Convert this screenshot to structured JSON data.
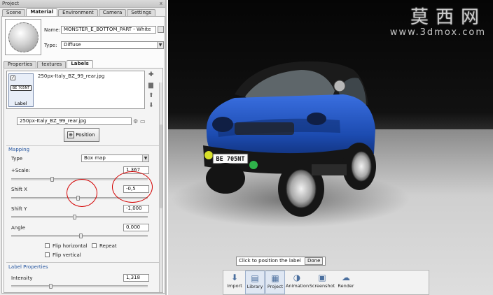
{
  "window": {
    "title": "Project",
    "close_glyph": "x"
  },
  "tabs_top": [
    {
      "label": "Scene",
      "active": false
    },
    {
      "label": "Material",
      "active": true
    },
    {
      "label": "Environment",
      "active": false
    },
    {
      "label": "Camera",
      "active": false
    },
    {
      "label": "Settings",
      "active": false
    }
  ],
  "material": {
    "name_label": "Name:",
    "name_value": "MONSTER_E_BOTTOM_PART - White",
    "type_label": "Type:",
    "type_value": "Diffuse"
  },
  "tabs_sub": [
    {
      "label": "Properties",
      "active": false
    },
    {
      "label": "textures",
      "active": false
    },
    {
      "label": "Labels",
      "active": true
    }
  ],
  "labels": {
    "item_file": "250px-Italy_BZ_99_rear.jpg",
    "item_caption": "Label",
    "thumb_text": "BE 705NT",
    "file_field": "250px-Italy_BZ_99_rear.jpg",
    "position_button": "Position"
  },
  "mapping": {
    "section": "Mapping",
    "type_label": "Type",
    "type_value": "Box map",
    "scale_label": "+Scale:",
    "scale_value": "1,367",
    "shiftx_label": "Shift X",
    "shiftx_value": "-0,5",
    "shifty_label": "Shift Y",
    "shifty_value": "-1,000",
    "angle_label": "Angle",
    "angle_value": "0,000",
    "flip_h": "Flip horizontal",
    "repeat": "Repeat",
    "flip_v": "Flip vertical"
  },
  "label_props": {
    "section": "Label Properties",
    "intensity_label": "Intensity",
    "intensity_value": "1,318"
  },
  "viewport": {
    "watermark_cn": "莫西网",
    "watermark_url": "www.3dmox.com",
    "plate_text": "BE 705NT",
    "hint": "Click to position the label",
    "done": "Done"
  },
  "toolbar": [
    {
      "label": "Import",
      "icon": "import-icon",
      "glyph": "⬇"
    },
    {
      "label": "Library",
      "icon": "library-icon",
      "glyph": "▤"
    },
    {
      "label": "Project",
      "icon": "project-icon",
      "glyph": "▦"
    },
    {
      "label": "Animation",
      "icon": "animation-icon",
      "glyph": "◑"
    },
    {
      "label": "Screenshot",
      "icon": "screenshot-icon",
      "glyph": "▣"
    },
    {
      "label": "Render",
      "icon": "render-icon",
      "glyph": "☁"
    }
  ],
  "colors": {
    "accent": "#2455a0",
    "car_blue": "#1e4fb5",
    "highlight_circle": "#d40000"
  }
}
